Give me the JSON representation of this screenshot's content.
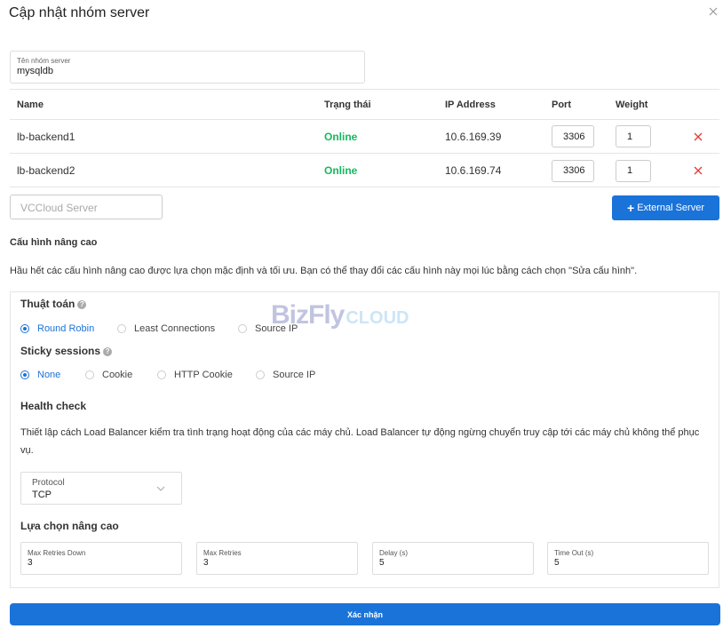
{
  "dialog": {
    "title": "Cập nhật nhóm server"
  },
  "group_name": {
    "label": "Tên nhóm server",
    "value": "mysqldb"
  },
  "table": {
    "headers": [
      "Name",
      "Trạng thái",
      "IP Address",
      "Port",
      "Weight"
    ],
    "rows": [
      {
        "name": "lb-backend1",
        "status": "Online",
        "ip": "10.6.169.39",
        "port": "3306",
        "weight": "1"
      },
      {
        "name": "lb-backend2",
        "status": "Online",
        "ip": "10.6.169.74",
        "port": "3306",
        "weight": "1"
      }
    ]
  },
  "server_input": {
    "placeholder": "VCCloud Server"
  },
  "external_button": {
    "label": "External Server"
  },
  "advanced": {
    "title": "Cấu hình nâng cao",
    "description": "Hầu hết các cấu hình nâng cao được lựa chọn mặc định và tối ưu. Bạn có thể thay đổi các cấu hình này mọi lúc bằng cách chọn \"Sửa cấu hình\"."
  },
  "watermark": {
    "part1": "BizFly",
    "part2": "CLOUD"
  },
  "algorithm": {
    "label": "Thuật toán",
    "options": [
      "Round Robin",
      "Least Connections",
      "Source IP"
    ],
    "selected": "Round Robin"
  },
  "sticky": {
    "label": "Sticky sessions",
    "options": [
      "None",
      "Cookie",
      "HTTP Cookie",
      "Source IP"
    ],
    "selected": "None"
  },
  "health_check": {
    "label": "Health check",
    "description": "Thiết lập cách Load Balancer kiểm tra tình trạng hoạt động của các máy chủ. Load Balancer tự động ngừng chuyển truy cập tới các máy chủ không thể phục vụ.",
    "protocol_label": "Protocol",
    "protocol_value": "TCP"
  },
  "options": {
    "label": "Lựa chọn nâng cao",
    "fields": [
      {
        "label": "Max Retries Down",
        "value": "3"
      },
      {
        "label": "Max Retries",
        "value": "3"
      },
      {
        "label": "Delay (s)",
        "value": "5"
      },
      {
        "label": "Time Out (s)",
        "value": "5"
      }
    ]
  },
  "confirm_button": {
    "label": "Xác nhận"
  },
  "colors": {
    "primary": "#1a73d9",
    "online": "#16b85f",
    "delete": "#e53935"
  },
  "icons": [
    "close-icon",
    "delete-icon",
    "plus-icon",
    "help-icon",
    "chevron-down-icon"
  ]
}
